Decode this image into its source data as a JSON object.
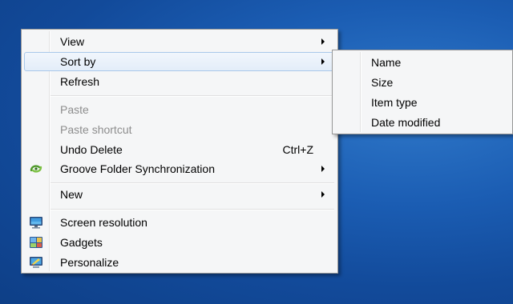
{
  "context_menu": {
    "items": [
      {
        "label": "View",
        "has_submenu": true
      },
      {
        "label": "Sort by",
        "has_submenu": true,
        "highlighted": true
      },
      {
        "label": "Refresh"
      },
      {
        "label": "Paste",
        "disabled": true
      },
      {
        "label": "Paste shortcut",
        "disabled": true
      },
      {
        "label": "Undo Delete",
        "shortcut": "Ctrl+Z"
      },
      {
        "label": "Groove Folder Synchronization",
        "has_submenu": true,
        "icon": "groove-sync-icon"
      },
      {
        "label": "New",
        "has_submenu": true
      },
      {
        "label": "Screen resolution",
        "icon": "screen-resolution-icon"
      },
      {
        "label": "Gadgets",
        "icon": "gadgets-icon"
      },
      {
        "label": "Personalize",
        "icon": "personalize-icon"
      }
    ]
  },
  "sort_submenu": {
    "items": [
      {
        "label": "Name"
      },
      {
        "label": "Size"
      },
      {
        "label": "Item type"
      },
      {
        "label": "Date modified"
      }
    ]
  },
  "colors": {
    "desktop_blue": "#1b5db3",
    "menu_background": "#f5f6f7",
    "hover_border": "#a8c8ea",
    "disabled_text": "#8d8d8d"
  }
}
